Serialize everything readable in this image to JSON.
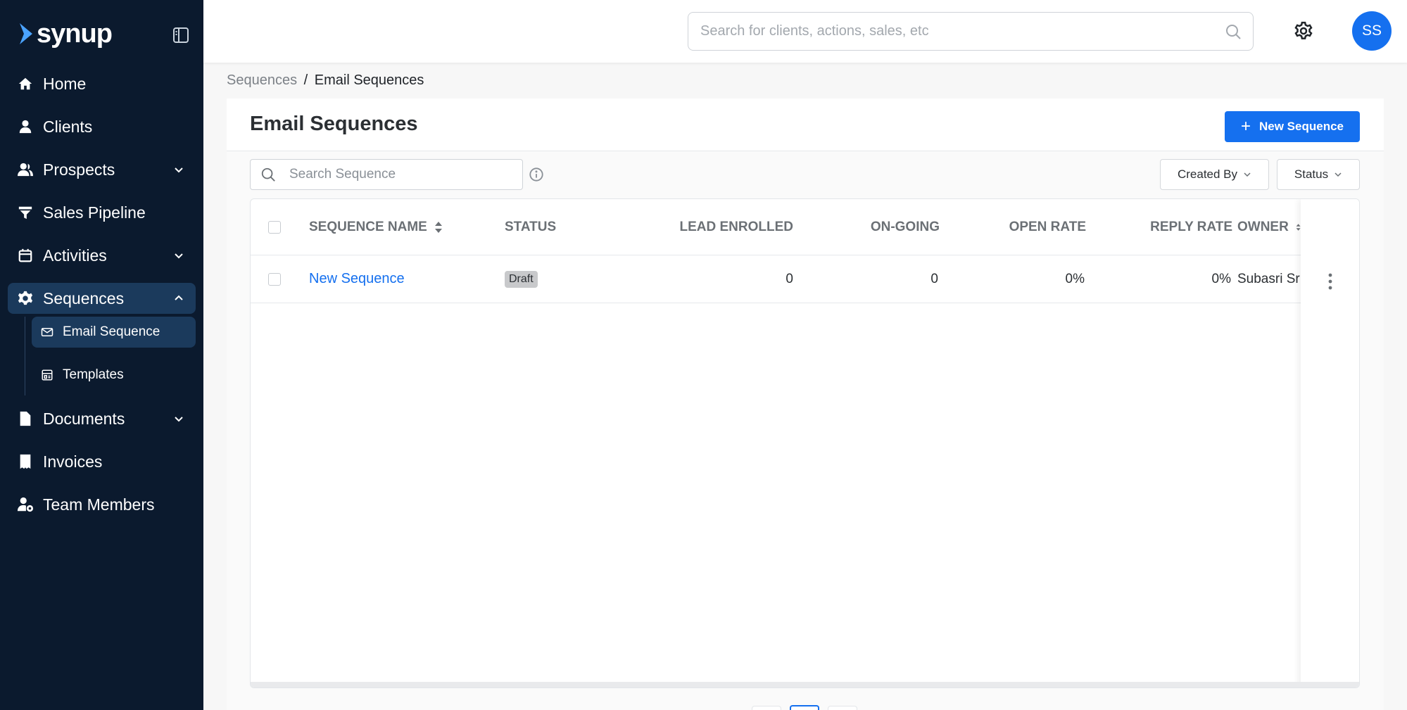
{
  "app": {
    "logo_text": "synup",
    "brand_color": "#1570ef",
    "sidebar_bg": "#0b1a2e"
  },
  "sidebar": {
    "items": [
      {
        "label": "Home",
        "icon": "home-icon"
      },
      {
        "label": "Clients",
        "icon": "user-icon"
      },
      {
        "label": "Prospects",
        "icon": "users-icon",
        "expandable": true
      },
      {
        "label": "Sales Pipeline",
        "icon": "funnel-icon"
      },
      {
        "label": "Activities",
        "icon": "calendar-icon",
        "expandable": true
      },
      {
        "label": "Sequences",
        "icon": "gear-icon",
        "expandable": true,
        "expanded": true,
        "active": true
      },
      {
        "label": "Documents",
        "icon": "document-icon",
        "expandable": true
      },
      {
        "label": "Invoices",
        "icon": "invoice-icon"
      },
      {
        "label": "Team Members",
        "icon": "user-cog-icon"
      }
    ],
    "sequences_sub": [
      {
        "label": "Email Sequence",
        "icon": "mail-icon",
        "active": true
      },
      {
        "label": "Templates",
        "icon": "template-icon"
      }
    ]
  },
  "topbar": {
    "search_placeholder": "Search for clients, actions, sales, etc",
    "avatar_initials": "SS"
  },
  "breadcrumb": {
    "parent": "Sequences",
    "separator": "/",
    "current": "Email Sequences"
  },
  "page": {
    "title": "Email Sequences",
    "new_button": "New Sequence",
    "search_placeholder": "Search Sequence",
    "filters": {
      "created_by": "Created By",
      "status": "Status"
    }
  },
  "table": {
    "columns": {
      "name": "SEQUENCE NAME",
      "status": "STATUS",
      "lead_enrolled": "LEAD ENROLLED",
      "ongoing": "ON-GOING",
      "open_rate": "OPEN RATE",
      "reply_rate": "REPLY RATE",
      "owner": "OWNER"
    },
    "rows": [
      {
        "name": "New Sequence",
        "status": "Draft",
        "lead_enrolled": "0",
        "ongoing": "0",
        "open_rate": "0%",
        "reply_rate": "0%",
        "owner": "Subasri Sr"
      }
    ]
  }
}
